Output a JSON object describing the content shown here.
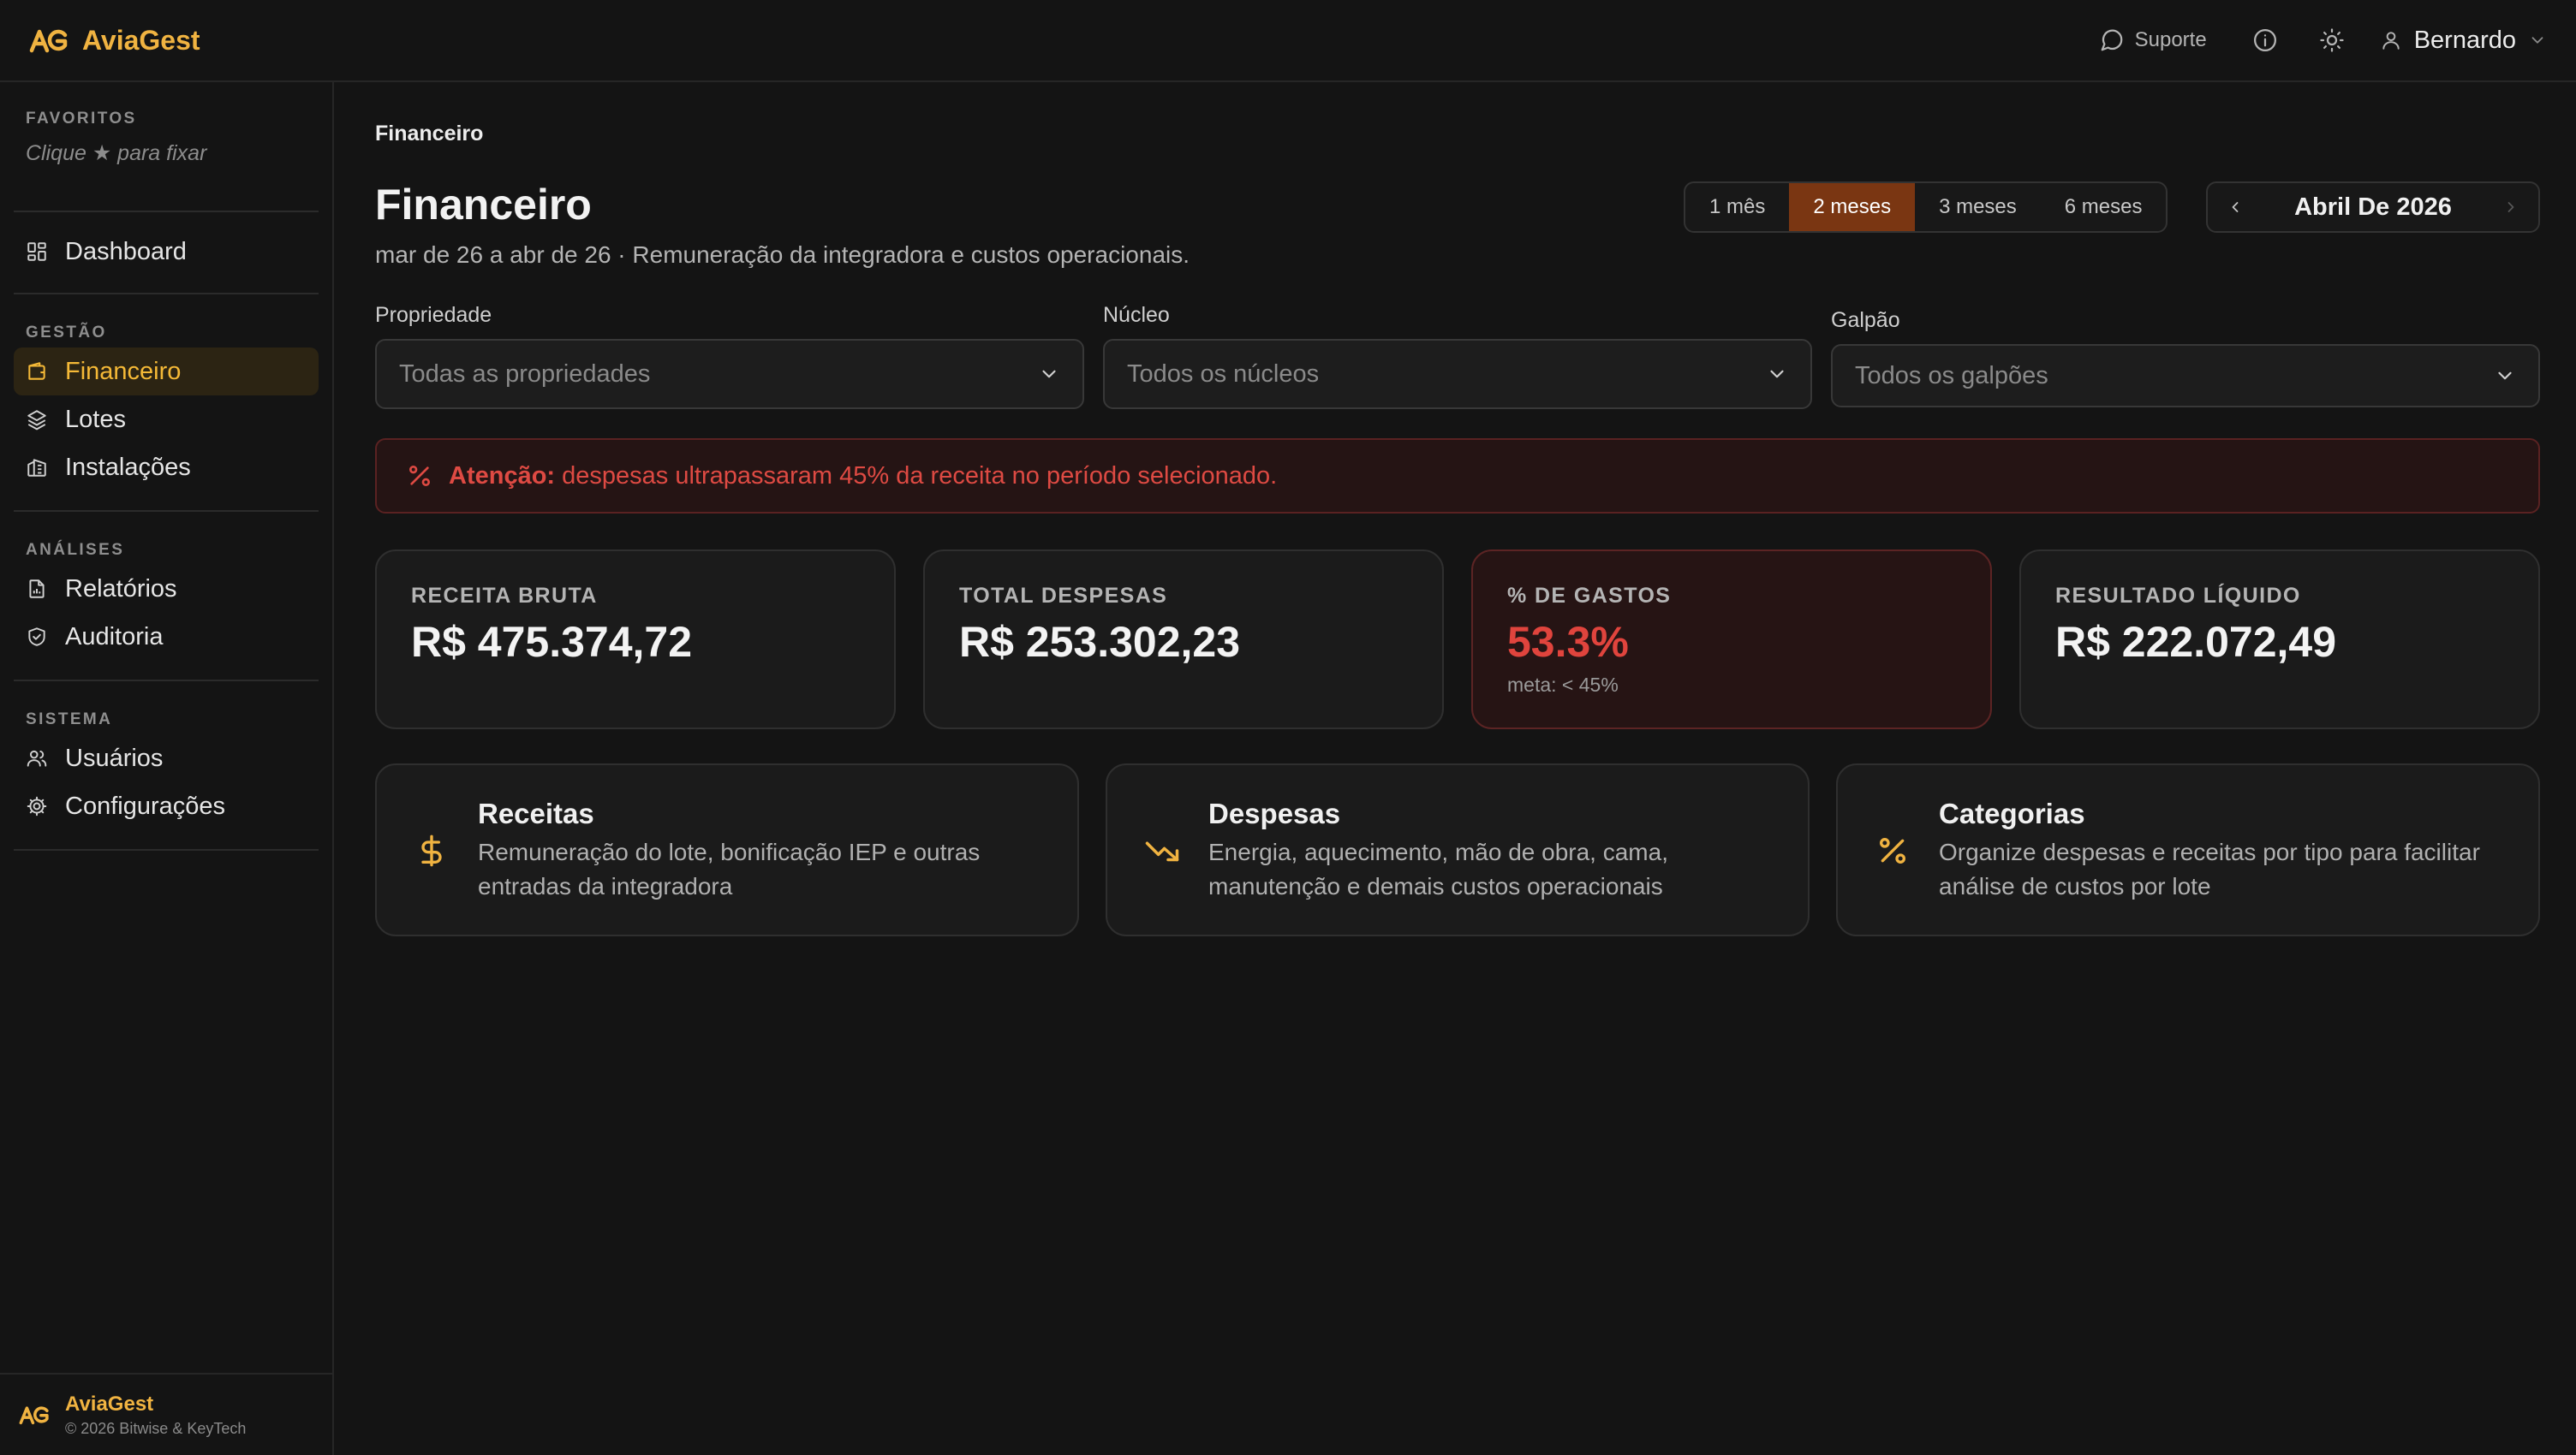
{
  "app": {
    "name": "AviaGest"
  },
  "header": {
    "support_label": "Suporte",
    "user_name": "Bernardo",
    "icons": [
      "message-circle-icon",
      "info-icon",
      "sun-icon",
      "user-icon",
      "chevron-down-icon"
    ]
  },
  "sidebar": {
    "favorites_title": "FAVORITOS",
    "favorites_hint": "Clique ★ para fixar",
    "dashboard": "Dashboard",
    "sections": [
      {
        "title": "GESTÃO",
        "items": [
          {
            "label": "Financeiro",
            "icon": "wallet-icon",
            "active": true
          },
          {
            "label": "Lotes",
            "icon": "layers-icon"
          },
          {
            "label": "Instalações",
            "icon": "building-icon"
          }
        ]
      },
      {
        "title": "ANÁLISES",
        "items": [
          {
            "label": "Relatórios",
            "icon": "file-chart-icon"
          },
          {
            "label": "Auditoria",
            "icon": "shield-check-icon"
          }
        ]
      },
      {
        "title": "SISTEMA",
        "items": [
          {
            "label": "Usuários",
            "icon": "users-icon"
          },
          {
            "label": "Configurações",
            "icon": "gear-icon"
          }
        ]
      }
    ],
    "footer": {
      "brand": "AviaGest",
      "copyright": "© 2026 Bitwise & KeyTech"
    }
  },
  "page": {
    "breadcrumb": "Financeiro",
    "title": "Financeiro",
    "subtitle": "mar de 26 a abr de 26 · Remuneração da integradora e custos operacionais."
  },
  "period": {
    "options": [
      "1 mês",
      "2 meses",
      "3 meses",
      "6 meses"
    ],
    "selected": "2 meses",
    "month": "Abril De 2026"
  },
  "filters": {
    "property": {
      "label": "Propriedade",
      "value": "Todas as propriedades"
    },
    "nucleus": {
      "label": "Núcleo",
      "value": "Todos os núcleos"
    },
    "shed": {
      "label": "Galpão",
      "value": "Todos os galpões"
    }
  },
  "alert": {
    "prefix": "Atenção:",
    "message": " despesas ultrapassaram 45% da receita no período selecionado.",
    "color": "#de4a43"
  },
  "stats": {
    "revenue": {
      "label": "RECEITA BRUTA",
      "value": "R$ 475.374,72"
    },
    "expenses": {
      "label": "TOTAL DESPESAS",
      "value": "R$ 253.302,23"
    },
    "spend_pct": {
      "label": "% DE GASTOS",
      "value": "53.3%",
      "meta": "meta: < 45%",
      "color": "#e0443d"
    },
    "net": {
      "label": "RESULTADO LÍQUIDO",
      "value": "R$ 222.072,49"
    }
  },
  "cards": {
    "revenues": {
      "title": "Receitas",
      "desc": "Remuneração do lote, bonificação IEP e outras entradas da integradora",
      "icon": "dollar-icon"
    },
    "expenses": {
      "title": "Despesas",
      "desc": "Energia, aquecimento, mão de obra, cama, manutenção e demais custos operacionais",
      "icon": "trending-down-icon"
    },
    "categories": {
      "title": "Categorias",
      "desc": "Organize despesas e receitas por tipo para facilitar análise de custos por lote",
      "icon": "percent-icon"
    }
  },
  "colors": {
    "accent": "#f0b341",
    "active_bg": "#2c2413",
    "segment_active": "#7a3612",
    "danger": "#e0443d"
  }
}
